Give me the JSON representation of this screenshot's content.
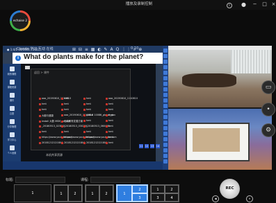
{
  "window": {
    "title": "播放及录制控制",
    "info_glyph": "i",
    "dot_glyph": "●",
    "minimize_glyph": "−",
    "maximize_glyph": "□",
    "close_glyph": "×"
  },
  "logo": {
    "text": "echaise 2"
  },
  "share": {
    "header_text": "ClassIn 学习 互动 在线",
    "header_right": "0:10",
    "question": "What do plants make for the planet?",
    "question_icon": "i",
    "sidebar_items": [
      "我的课程",
      "课程资源",
      "课件",
      "云盘",
      "分享管理",
      "学习中心",
      "个人设置"
    ],
    "breadcrumb": "返回 > 课件",
    "files": [
      "aaa_20190610_1110810",
      "hmt",
      "hmt",
      "aaa_20190610_1110810",
      "hmt",
      "hmt",
      "hmt",
      "hmt",
      "hmt",
      "hmt",
      "hmt",
      "hmt",
      "大脑与健康",
      "aaa_20190610_1110810",
      "global 10086_global_gov",
      "hmt",
      "install 大数 MSM_ansible",
      "在线教育发展方案",
      "hmt",
      "hmt",
      "_20180513_023848",
      "_20180513_030236",
      "_20180513_060400",
      "hmt",
      "hmt",
      "hmt",
      "hmt",
      "hmt",
      "https://www.youtube.com",
      "https://www.youtube.com",
      "https://www.youtube.com",
      "hmt",
      "20181212121804",
      "20181212121804",
      "20181212121804",
      "hmt"
    ],
    "taskbar_text": "本机共享资源",
    "tiles": [
      "11",
      "12",
      "13",
      "14"
    ],
    "footer_left": "● 1:4/1 10/1001 / 2017",
    "footer_tools": "⊞ ⊟ ≡ ▦ ◐ ✎ A Q ⋮⋮ ⌕ ⊕"
  },
  "bottom": {
    "title_label": "标题:",
    "title_value": "",
    "lesson_label": "课程:",
    "lesson_value": "",
    "layouts": [
      {
        "name": "single",
        "cells": [
          "1"
        ]
      },
      {
        "name": "two-up",
        "cells": [
          "1",
          "2"
        ]
      },
      {
        "name": "two-up-alt",
        "cells": [
          "1",
          "2"
        ]
      },
      {
        "name": "one-plus-two",
        "cells": [
          "1",
          "2",
          "3"
        ]
      },
      {
        "name": "quad",
        "cells": [
          "1",
          "2",
          "3",
          "4"
        ]
      }
    ],
    "rec_label": "REC",
    "ctrl_left_glyph": "◀",
    "ctrl_right_glyph": "⏸"
  },
  "side_controls": [
    "monitor-icon",
    "dot-icon",
    "gear-icon"
  ],
  "colors": {
    "accent": "#2f7ee0",
    "share_header": "#203a62",
    "tool_column": "#1e3f7a"
  }
}
